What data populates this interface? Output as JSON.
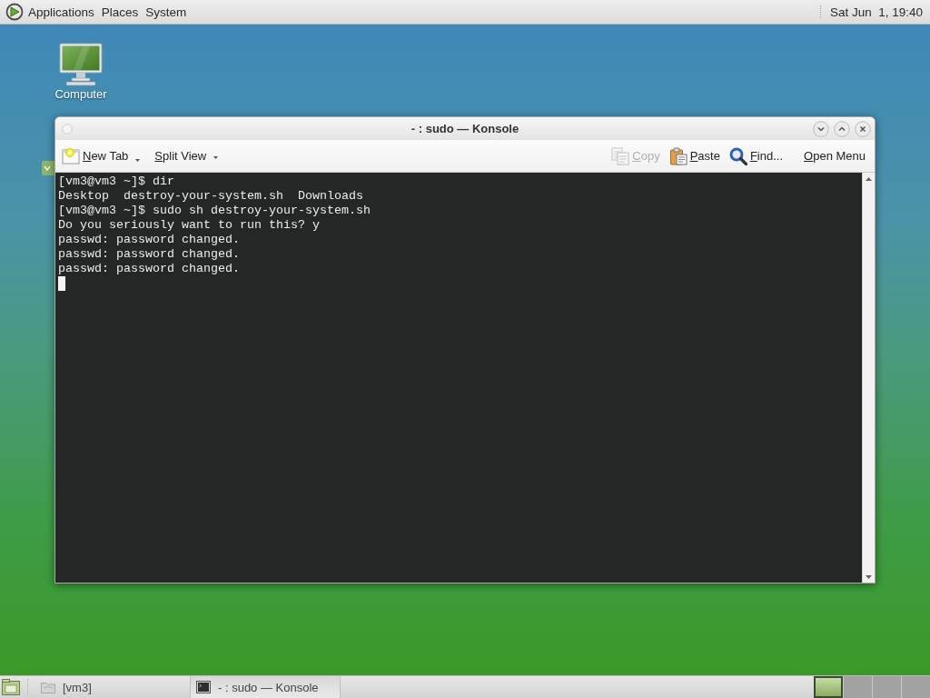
{
  "top_panel": {
    "menus": [
      {
        "label": "Applications"
      },
      {
        "label": "Places"
      },
      {
        "label": "System"
      }
    ],
    "clock": "Sat Jun  1, 19:40"
  },
  "desktop": {
    "icons": [
      {
        "label": "Computer"
      }
    ]
  },
  "window": {
    "title": "- : sudo — Konsole",
    "toolbar": {
      "new_tab": {
        "label": "New Tab",
        "disabled": false
      },
      "split_view": {
        "label": "Split View",
        "disabled": false
      },
      "copy": {
        "label": "Copy",
        "disabled": true
      },
      "paste": {
        "label": "Paste",
        "disabled": false
      },
      "find": {
        "label": "Find...",
        "disabled": false
      },
      "open_menu": {
        "label": "Open Menu",
        "disabled": false
      }
    },
    "terminal": {
      "lines": [
        "[vm3@vm3 ~]$ dir",
        "Desktop  destroy-your-system.sh  Downloads",
        "[vm3@vm3 ~]$ sudo sh destroy-your-system.sh",
        "Do you seriously want to run this? y",
        "passwd: password changed.",
        "passwd: password changed.",
        "passwd: password changed."
      ],
      "cursor": true
    }
  },
  "bottom_panel": {
    "tasks": [
      {
        "kind": "folder",
        "label": "[vm3]",
        "selected": false
      },
      {
        "kind": "terminal",
        "label": "- : sudo — Konsole",
        "selected": true
      }
    ],
    "workspaces": [
      {
        "selected": true
      },
      {
        "selected": false
      },
      {
        "selected": false
      },
      {
        "selected": false
      }
    ]
  }
}
